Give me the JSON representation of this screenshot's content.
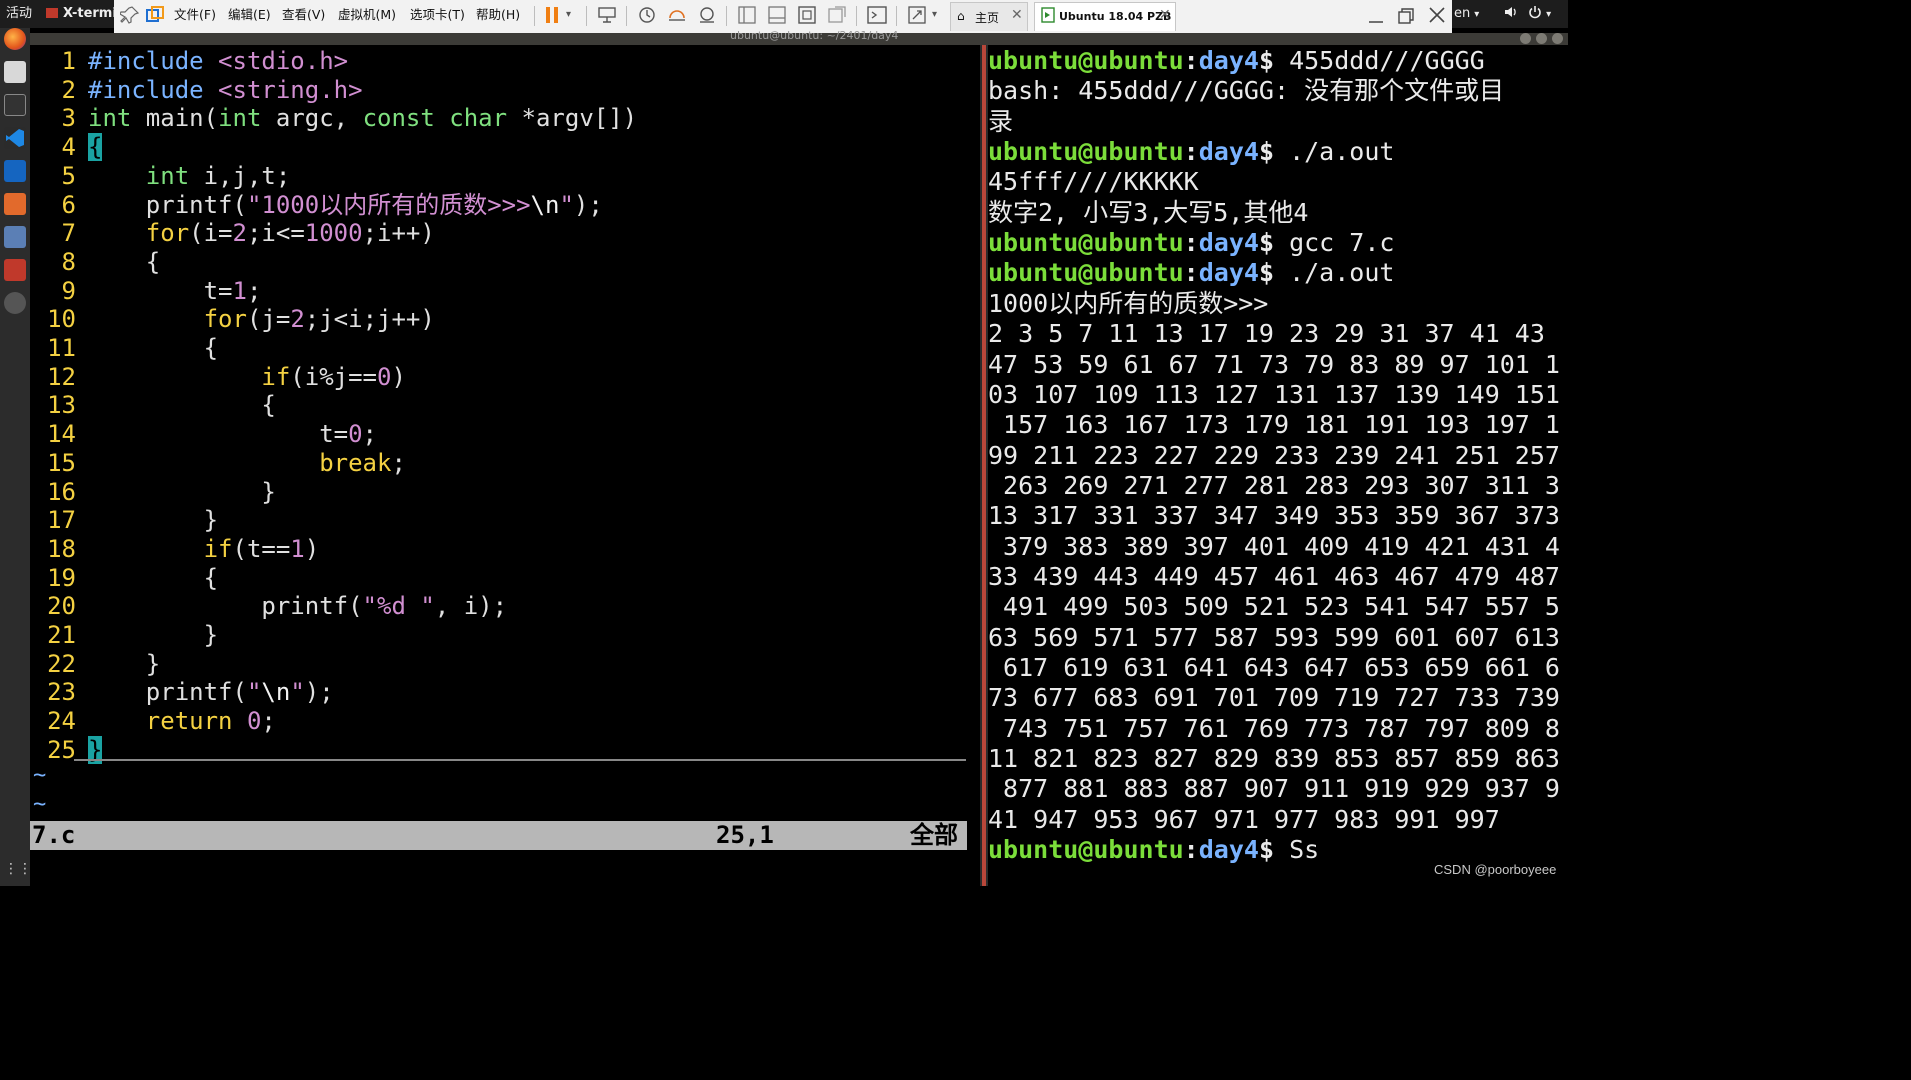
{
  "topbar": {
    "activities": "活动",
    "app_name": "X-termin",
    "lang": "en",
    "lang_arrow": "▾",
    "volume_icon": "speaker-icon",
    "power_icon": "power-icon"
  },
  "vmware": {
    "menus": [
      "文件(F)",
      "编辑(E)",
      "查看(V)",
      "虚拟机(M)",
      "选项卡(T)",
      "帮助(H)"
    ],
    "tabs": [
      {
        "label": "主页",
        "icon": "home-icon"
      },
      {
        "label": "Ubuntu 18.04 PZB",
        "icon": "vm-icon"
      }
    ]
  },
  "inner_window_title": "ubuntu@ubuntu: ~/2401/day4",
  "editor": {
    "lines": [
      {
        "n": "1",
        "segs": [
          [
            "#include",
            "pp"
          ],
          [
            " ",
            ""
          ],
          [
            "<stdio.h>",
            "inc"
          ]
        ]
      },
      {
        "n": "2",
        "segs": [
          [
            "#include",
            "pp"
          ],
          [
            " ",
            ""
          ],
          [
            "<string.h>",
            "inc"
          ]
        ]
      },
      {
        "n": "3",
        "segs": [
          [
            "int",
            "ty"
          ],
          [
            " main(",
            ""
          ],
          [
            "int",
            "ty"
          ],
          [
            " argc, ",
            ""
          ],
          [
            "const",
            "ty"
          ],
          [
            " ",
            ""
          ],
          [
            "char",
            "ty"
          ],
          [
            " *argv[])",
            ""
          ]
        ]
      },
      {
        "n": "4",
        "segs": [
          [
            "{",
            "cursor"
          ]
        ]
      },
      {
        "n": "5",
        "segs": [
          [
            "    ",
            ""
          ],
          [
            "int",
            "ty"
          ],
          [
            " i,j,t;",
            ""
          ]
        ]
      },
      {
        "n": "6",
        "segs": [
          [
            "    printf(",
            ""
          ],
          [
            "\"1000以内所有的质数>>>",
            "str"
          ],
          [
            "\\n",
            "esc"
          ],
          [
            "\"",
            "str"
          ],
          [
            ");",
            ""
          ]
        ]
      },
      {
        "n": "7",
        "segs": [
          [
            "    ",
            ""
          ],
          [
            "for",
            "kw"
          ],
          [
            "(i=",
            ""
          ],
          [
            "2",
            "num"
          ],
          [
            ";i<=",
            ""
          ],
          [
            "1000",
            "num"
          ],
          [
            ";i++)",
            ""
          ]
        ]
      },
      {
        "n": "8",
        "segs": [
          [
            "    {",
            ""
          ]
        ]
      },
      {
        "n": "9",
        "segs": [
          [
            "        t=",
            ""
          ],
          [
            "1",
            "num"
          ],
          [
            ";",
            ""
          ]
        ]
      },
      {
        "n": "10",
        "segs": [
          [
            "        ",
            ""
          ],
          [
            "for",
            "kw"
          ],
          [
            "(j=",
            ""
          ],
          [
            "2",
            "num"
          ],
          [
            ";j<i;j++)",
            ""
          ]
        ]
      },
      {
        "n": "11",
        "segs": [
          [
            "        {",
            ""
          ]
        ]
      },
      {
        "n": "12",
        "segs": [
          [
            "            ",
            ""
          ],
          [
            "if",
            "kw"
          ],
          [
            "(i%j==",
            ""
          ],
          [
            "0",
            "num"
          ],
          [
            ")",
            ""
          ]
        ]
      },
      {
        "n": "13",
        "segs": [
          [
            "            {",
            ""
          ]
        ]
      },
      {
        "n": "14",
        "segs": [
          [
            "                t=",
            ""
          ],
          [
            "0",
            "num"
          ],
          [
            ";",
            ""
          ]
        ]
      },
      {
        "n": "15",
        "segs": [
          [
            "                ",
            ""
          ],
          [
            "break",
            "kw"
          ],
          [
            ";",
            ""
          ]
        ]
      },
      {
        "n": "16",
        "segs": [
          [
            "            }",
            ""
          ]
        ]
      },
      {
        "n": "17",
        "segs": [
          [
            "        }",
            ""
          ]
        ]
      },
      {
        "n": "18",
        "segs": [
          [
            "        ",
            ""
          ],
          [
            "if",
            "kw"
          ],
          [
            "(t==",
            ""
          ],
          [
            "1",
            "num"
          ],
          [
            ")",
            ""
          ]
        ]
      },
      {
        "n": "19",
        "segs": [
          [
            "        {",
            ""
          ]
        ]
      },
      {
        "n": "20",
        "segs": [
          [
            "            printf(",
            ""
          ],
          [
            "\"%d \"",
            "str"
          ],
          [
            ", i);",
            ""
          ]
        ]
      },
      {
        "n": "21",
        "segs": [
          [
            "        }",
            ""
          ]
        ]
      },
      {
        "n": "22",
        "segs": [
          [
            "    }",
            ""
          ]
        ]
      },
      {
        "n": "23",
        "segs": [
          [
            "    printf(",
            ""
          ],
          [
            "\"",
            "str"
          ],
          [
            "\\n",
            "esc"
          ],
          [
            "\"",
            "str"
          ],
          [
            ");",
            ""
          ]
        ]
      },
      {
        "n": "24",
        "segs": [
          [
            "    ",
            ""
          ],
          [
            "return",
            "kw"
          ],
          [
            " ",
            ""
          ],
          [
            "0",
            "num"
          ],
          [
            ";",
            ""
          ]
        ]
      },
      {
        "n": "25",
        "segs": [
          [
            "}",
            "cursor"
          ]
        ]
      }
    ],
    "tildes": [
      "~",
      "~"
    ],
    "status": {
      "file": "7.c",
      "pos": "25,1",
      "scroll": "全部"
    }
  },
  "terminal": {
    "prompt_user": "ubuntu@ubuntu",
    "prompt_colon": ":",
    "prompt_dir": "day4",
    "prompt_dollar": "$ ",
    "lines": [
      {
        "prompt": true,
        "text": "455ddd///GGGG"
      },
      {
        "prompt": false,
        "text": "bash: 455ddd///GGGG: 没有那个文件或目"
      },
      {
        "prompt": false,
        "text": "录"
      },
      {
        "prompt": true,
        "text": "./a.out"
      },
      {
        "prompt": false,
        "text": "45fff////KKKKK"
      },
      {
        "prompt": false,
        "text": "数字2, 小写3,大写5,其他4"
      },
      {
        "prompt": true,
        "text": "gcc 7.c"
      },
      {
        "prompt": true,
        "text": "./a.out"
      },
      {
        "prompt": false,
        "text": "1000以内所有的质数>>>"
      },
      {
        "prompt": false,
        "text": "2 3 5 7 11 13 17 19 23 29 31 37 41 43"
      },
      {
        "prompt": false,
        "text": "47 53 59 61 67 71 73 79 83 89 97 101 1"
      },
      {
        "prompt": false,
        "text": "03 107 109 113 127 131 137 139 149 151"
      },
      {
        "prompt": false,
        "text": " 157 163 167 173 179 181 191 193 197 1"
      },
      {
        "prompt": false,
        "text": "99 211 223 227 229 233 239 241 251 257"
      },
      {
        "prompt": false,
        "text": " 263 269 271 277 281 283 293 307 311 3"
      },
      {
        "prompt": false,
        "text": "13 317 331 337 347 349 353 359 367 373"
      },
      {
        "prompt": false,
        "text": " 379 383 389 397 401 409 419 421 431 4"
      },
      {
        "prompt": false,
        "text": "33 439 443 449 457 461 463 467 479 487"
      },
      {
        "prompt": false,
        "text": " 491 499 503 509 521 523 541 547 557 5"
      },
      {
        "prompt": false,
        "text": "63 569 571 577 587 593 599 601 607 613"
      },
      {
        "prompt": false,
        "text": " 617 619 631 641 643 647 653 659 661 6"
      },
      {
        "prompt": false,
        "text": "73 677 683 691 701 709 719 727 733 739"
      },
      {
        "prompt": false,
        "text": " 743 751 757 761 769 773 787 797 809 8"
      },
      {
        "prompt": false,
        "text": "11 821 823 827 829 839 853 857 859 863"
      },
      {
        "prompt": false,
        "text": " 877 881 883 887 907 911 919 929 937 9"
      },
      {
        "prompt": false,
        "text": "41 947 953 967 971 977 983 991 997"
      },
      {
        "prompt": true,
        "text": "Ss"
      }
    ]
  },
  "watermark": "CSDN @poorboyeee",
  "colors": {
    "prompt_user": "#7bdd3a",
    "prompt_dir": "#7ab3ff",
    "line_numbers": "#f4d142",
    "keyword": "#f4d142",
    "type": "#7fe07f",
    "string_number": "#d18fd1",
    "preprocessor": "#7ab3ff",
    "cursor": "#1aa3a3",
    "divider": "#b8473a"
  }
}
